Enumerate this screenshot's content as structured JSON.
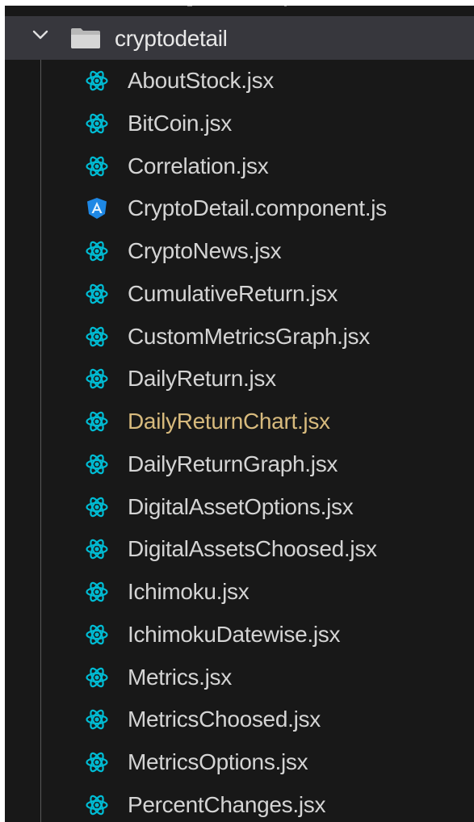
{
  "colors": {
    "panel_background": "#181818",
    "selected_folder_background": "#37373d",
    "file_text": "#d4d4d4",
    "modified_file_text": "#d7ba7d",
    "react_icon": "#00bcd4",
    "angular_icon": "#1e88e5"
  },
  "folder": {
    "name": "cryptodetail",
    "expanded": true,
    "chevron_icon": "chevron-down-icon",
    "icon": "folder-icon"
  },
  "files": [
    {
      "name": "AboutStock.jsx",
      "icon": "react-icon",
      "modified": false
    },
    {
      "name": "BitCoin.jsx",
      "icon": "react-icon",
      "modified": false
    },
    {
      "name": "Correlation.jsx",
      "icon": "react-icon",
      "modified": false
    },
    {
      "name": "CryptoDetail.component.js",
      "icon": "angular-icon",
      "modified": false
    },
    {
      "name": "CryptoNews.jsx",
      "icon": "react-icon",
      "modified": false
    },
    {
      "name": "CumulativeReturn.jsx",
      "icon": "react-icon",
      "modified": false
    },
    {
      "name": "CustomMetricsGraph.jsx",
      "icon": "react-icon",
      "modified": false
    },
    {
      "name": "DailyReturn.jsx",
      "icon": "react-icon",
      "modified": false
    },
    {
      "name": "DailyReturnChart.jsx",
      "icon": "react-icon",
      "modified": true
    },
    {
      "name": "DailyReturnGraph.jsx",
      "icon": "react-icon",
      "modified": false
    },
    {
      "name": "DigitalAssetOptions.jsx",
      "icon": "react-icon",
      "modified": false
    },
    {
      "name": "DigitalAssetsChoosed.jsx",
      "icon": "react-icon",
      "modified": false
    },
    {
      "name": "Ichimoku.jsx",
      "icon": "react-icon",
      "modified": false
    },
    {
      "name": "IchimokuDatewise.jsx",
      "icon": "react-icon",
      "modified": false
    },
    {
      "name": "Metrics.jsx",
      "icon": "react-icon",
      "modified": false
    },
    {
      "name": "MetricsChoosed.jsx",
      "icon": "react-icon",
      "modified": false
    },
    {
      "name": "MetricsOptions.jsx",
      "icon": "react-icon",
      "modified": false
    },
    {
      "name": "PercentChanges.jsx",
      "icon": "react-icon",
      "modified": false
    }
  ]
}
